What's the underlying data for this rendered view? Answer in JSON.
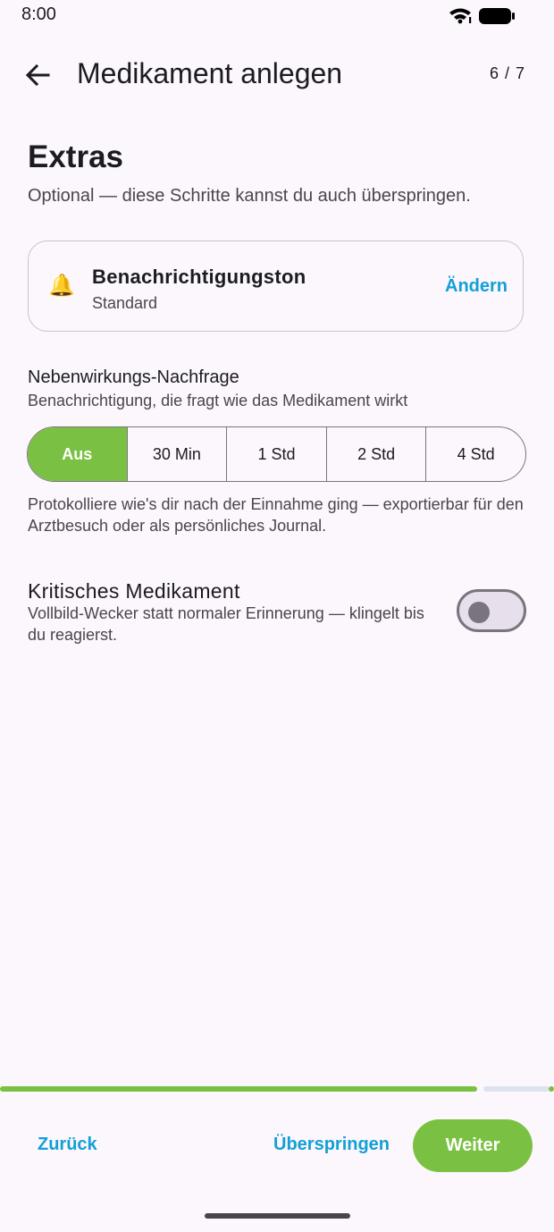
{
  "status_bar": {
    "time": "8:00"
  },
  "app_bar": {
    "title": "Medikament anlegen",
    "step": "6 / 7",
    "back_icon": "arrow-back-icon"
  },
  "section": {
    "title": "Extras",
    "subtitle": "Optional — diese Schritte kannst du auch überspringen."
  },
  "notification_sound": {
    "icon": "bell-icon",
    "icon_glyph": "🔔",
    "title": "Benachrichtigungston",
    "value": "Standard",
    "change_label": "Ändern"
  },
  "side_effects": {
    "title": "Nebenwirkungs-Nachfrage",
    "subtitle": "Benachrichtigung, die fragt wie das Medikament wirkt",
    "options": [
      "Aus",
      "30 Min",
      "1 Std",
      "2 Std",
      "4 Std"
    ],
    "selected_option": "Aus",
    "description": "Protokolliere wie's dir nach der Einnahme ging — exportierbar für den Arztbesuch oder als persönliches Journal."
  },
  "critical": {
    "title": "Kritisches Medikament",
    "description": "Vollbild-Wecker statt normaler Erinnerung — klingelt bis du reagierst.",
    "enabled": false
  },
  "progress": {
    "current_step": 6,
    "total_steps": 7
  },
  "footer": {
    "back_label": "Zurück",
    "skip_label": "Überspringen",
    "next_label": "Weiter"
  },
  "colors": {
    "accent_green": "#7ac143",
    "link_blue": "#12a0d7",
    "background": "#fcf7fc",
    "outline": "#79747e"
  }
}
